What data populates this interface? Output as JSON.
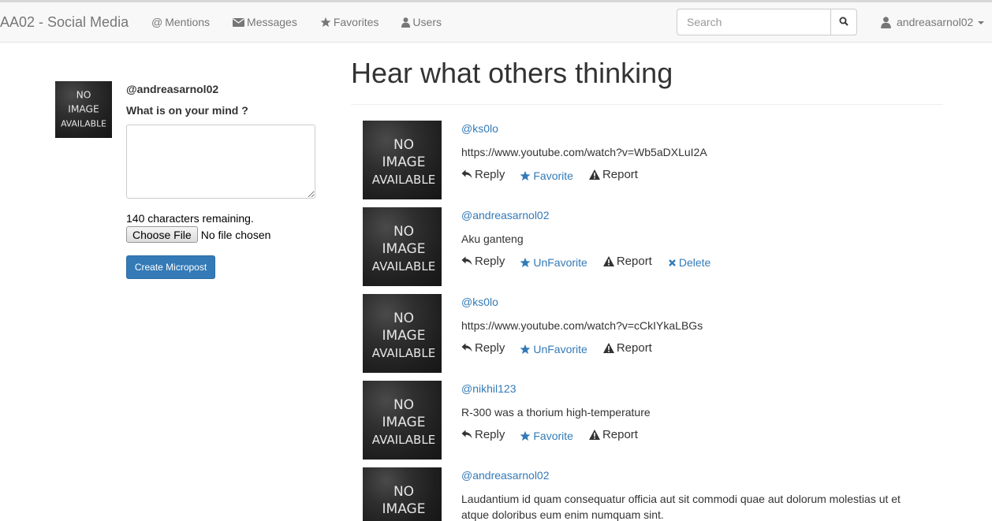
{
  "navbar": {
    "brand": "AA02 - Social Media",
    "links": [
      {
        "label": "Mentions",
        "icon": "at-icon"
      },
      {
        "label": "Messages",
        "icon": "envelope-icon"
      },
      {
        "label": "Favorites",
        "icon": "star-icon"
      },
      {
        "label": "Users",
        "icon": "user-icon"
      }
    ],
    "search_placeholder": "Search",
    "user": "andreasarnol02"
  },
  "sidebar": {
    "avatar_text": [
      "NO",
      "IMAGE",
      "AVAILABLE"
    ],
    "username": "@andreasarnol02",
    "prompt": "What is on your mind ?",
    "chars_remaining": "140 characters remaining.",
    "file_button": "Choose File",
    "file_status": "No file chosen",
    "submit": "Create Micropost"
  },
  "feed": {
    "title": "Hear what others thinking",
    "image_text": [
      "NO",
      "IMAGE",
      "AVAILABLE"
    ],
    "posts": [
      {
        "user": "@ks0lo",
        "content": "https://www.youtube.com/watch?v=Wb5aDXLuI2A",
        "reply": "Reply",
        "favorite": "Favorite",
        "report": "Report"
      },
      {
        "user": "@andreasarnol02",
        "content": "Aku ganteng",
        "reply": "Reply",
        "favorite": "UnFavorite",
        "report": "Report",
        "delete": "Delete"
      },
      {
        "user": "@ks0lo",
        "content": "https://www.youtube.com/watch?v=cCkIYkaLBGs",
        "reply": "Reply",
        "favorite": "UnFavorite",
        "report": "Report"
      },
      {
        "user": "@nikhil123",
        "content": "R-300 was a thorium high-temperature",
        "reply": "Reply",
        "favorite": "Favorite",
        "report": "Report"
      },
      {
        "user": "@andreasarnol02",
        "content": "Laudantium id quam consequatur officia aut sit commodi quae aut dolorum molestias ut et atque doloribus eum enim numquam sint."
      }
    ]
  },
  "colors": {
    "link": "#337ab7",
    "primary_button": "#337ab7",
    "navbar_bg": "#f8f8f8",
    "nav_text": "#777777"
  }
}
